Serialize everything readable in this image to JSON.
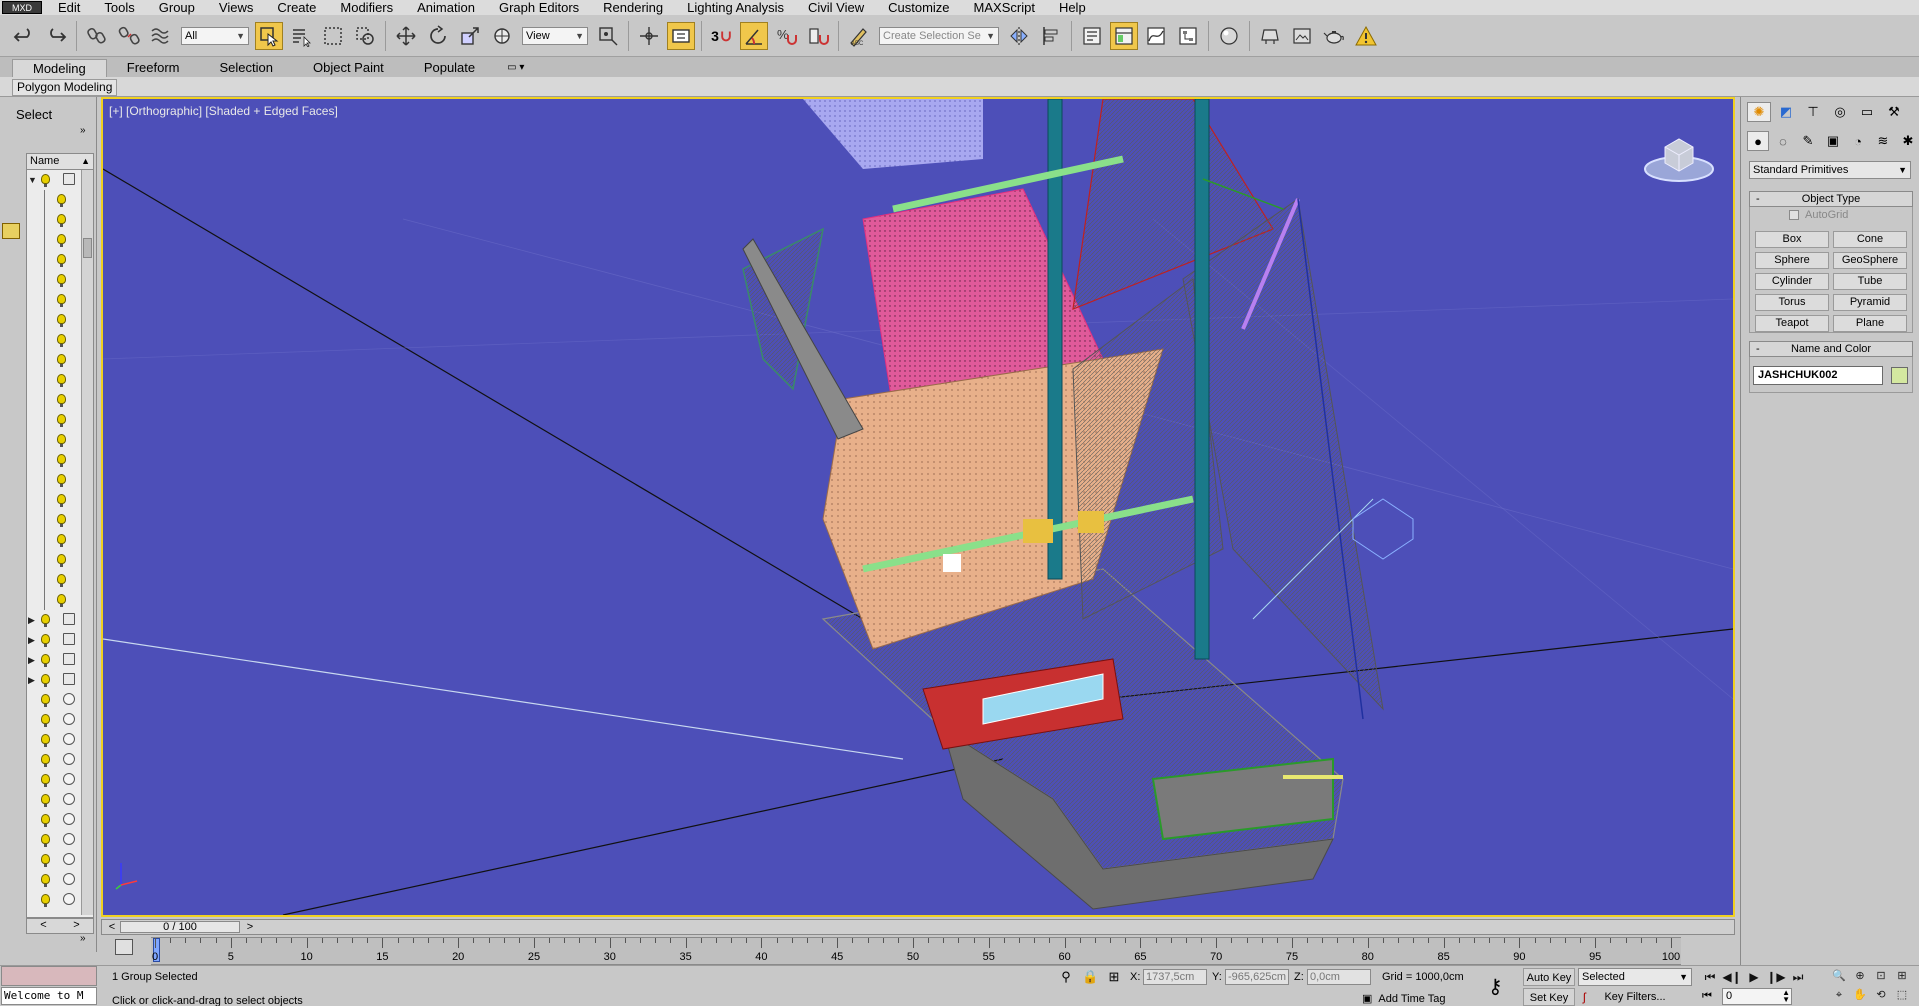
{
  "app": {
    "logo": "MXD",
    "colors": {
      "viewport_bg": "#4d4fb8",
      "active_border": "#f0d020",
      "active_button": "#f0c74b",
      "object_color": "#d4e8a0"
    }
  },
  "menu": [
    "Edit",
    "Tools",
    "Group",
    "Views",
    "Create",
    "Modifiers",
    "Animation",
    "Graph Editors",
    "Rendering",
    "Lighting Analysis",
    "Civil View",
    "Customize",
    "MAXScript",
    "Help"
  ],
  "toolbar": {
    "selection_filter": "All",
    "reference_coord": "View",
    "snaps_label": "3",
    "named_selection_placeholder": "Create Selection Se"
  },
  "ribbon": {
    "tabs": [
      "Modeling",
      "Freeform",
      "Selection",
      "Object Paint",
      "Populate"
    ],
    "active_tab": "Modeling",
    "panel_label": "Polygon Modeling"
  },
  "scene_explorer": {
    "title": "Select",
    "column_name": "Name"
  },
  "viewport": {
    "label": "[+] [Orthographic] [Shaded + Edged Faces]"
  },
  "time_slider": {
    "position": "0 / 100",
    "prev": "<",
    "next": ">"
  },
  "track_bar": {
    "labels": [
      "0",
      "5",
      "10",
      "15",
      "20",
      "25",
      "30",
      "35",
      "40",
      "45",
      "50",
      "55",
      "60",
      "65",
      "70",
      "75",
      "80",
      "85",
      "90",
      "95",
      "100"
    ]
  },
  "status": {
    "listener": "Welcome to M",
    "selection": "1 Group Selected",
    "prompt": "Click or click-and-drag to select objects",
    "x_label": "X:",
    "x_value": "1737,5cm",
    "y_label": "Y:",
    "y_value": "-965,625cm",
    "z_label": "Z:",
    "z_value": "0,0cm",
    "grid": "Grid = 1000,0cm",
    "add_time_tag": "Add Time Tag",
    "auto_key": "Auto Key",
    "set_key": "Set Key",
    "key_mode": "Selected",
    "key_filters": "Key Filters...",
    "frame": "0"
  },
  "command_panel": {
    "category": "Standard Primitives",
    "object_type_title": "Object Type",
    "autogrid": "AutoGrid",
    "primitives": [
      "Box",
      "Cone",
      "Sphere",
      "GeoSphere",
      "Cylinder",
      "Tube",
      "Torus",
      "Pyramid",
      "Teapot",
      "Plane"
    ],
    "name_color_title": "Name and Color",
    "object_name": "JASHCHUK002"
  }
}
